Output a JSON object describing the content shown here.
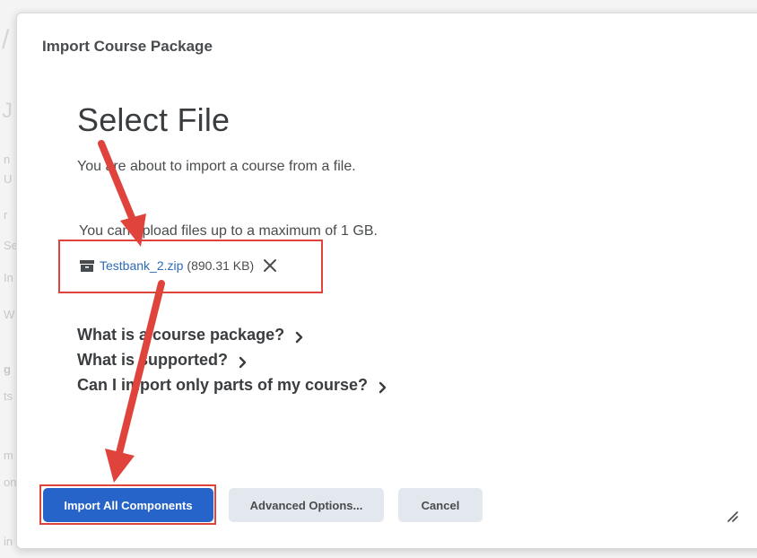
{
  "background": {
    "fragments": [
      "/",
      "J",
      "n",
      "U",
      "r",
      "Se",
      "In",
      "W",
      "g",
      "ts",
      "m",
      "on",
      "in"
    ]
  },
  "dialog": {
    "title": "Import Course Package",
    "heading": "Select File",
    "intro": "You are about to import a course from a file.",
    "max_size_text": "You can upload files up to a maximum of 1 GB.",
    "file": {
      "name": "Testbank_2.zip",
      "size": "(890.31 KB)",
      "icon": "archive-icon",
      "remove_icon": "close-icon"
    },
    "faq": [
      {
        "label": "What is a course package?"
      },
      {
        "label": "What is supported?"
      },
      {
        "label": "Can I import only parts of my course?"
      }
    ],
    "buttons": {
      "import_all": "Import All Components",
      "advanced": "Advanced Options...",
      "cancel": "Cancel"
    }
  },
  "colors": {
    "primary": "#2764c9",
    "annotation": "#e0433c",
    "link": "#2d6bb5"
  }
}
